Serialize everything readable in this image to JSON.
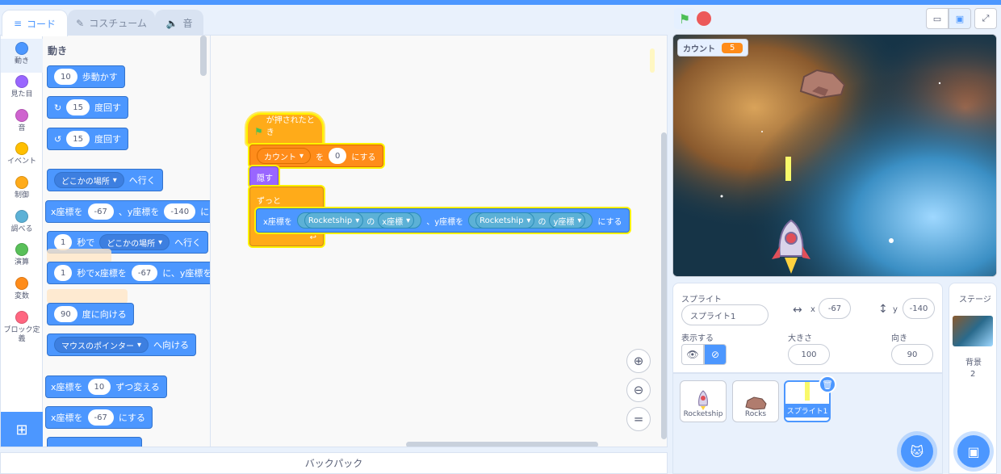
{
  "tabs": {
    "code": "コード",
    "costumes": "コスチューム",
    "sounds": "音"
  },
  "categories": [
    {
      "label": "動き",
      "color": "#4c97ff"
    },
    {
      "label": "見た目",
      "color": "#9966ff"
    },
    {
      "label": "音",
      "color": "#cf63cf"
    },
    {
      "label": "イベント",
      "color": "#ffbf00"
    },
    {
      "label": "制御",
      "color": "#ffab19"
    },
    {
      "label": "調べる",
      "color": "#5cb1d6"
    },
    {
      "label": "演算",
      "color": "#59c059"
    },
    {
      "label": "変数",
      "color": "#ff8c1a"
    },
    {
      "label": "ブロック定義",
      "color": "#ff6680"
    }
  ],
  "flyout": {
    "title": "動き",
    "move_val": "10",
    "move_label": "歩動かす",
    "turn_r_val": "15",
    "turn_r_label": "度回す",
    "turn_l_val": "15",
    "turn_l_label": "度回す",
    "goto_dd": "どこかの場所",
    "goto_label": "へ行く",
    "gotoxy_x_label": "x座標を",
    "gotoxy_x": "-67",
    "gotoxy_y_label": "、y座標を",
    "gotoxy_y": "-140",
    "gotoxy_end": "にする",
    "glide_val": "1",
    "glide_mid": "秒で",
    "glide_dd": "どこかの場所",
    "glide_end": "へ行く",
    "glidexy_val": "1",
    "glidexy_mid": "秒でx座標を",
    "glidexy_x": "-67",
    "glidexy_y_label": "に、y座標を",
    "point_val": "90",
    "point_label": "度に向ける",
    "pointto_dd": "マウスのポインター",
    "pointto_label": "へ向ける",
    "changex_label": "x座標を",
    "changex_val": "10",
    "changex_end": "ずつ変える",
    "setx_label": "x座標を",
    "setx_val": "-67",
    "setx_end": "にする"
  },
  "script": {
    "hat_label": "が押されたとき",
    "setvar_dd": "カウント",
    "setvar_mid": "を",
    "setvar_val": "0",
    "setvar_end": "にする",
    "hide_label": "隠す",
    "forever_label": "ずっと",
    "go_x_label": "x座標を",
    "go_x_sprite": "Rocketship",
    "go_of1": "の",
    "go_x_prop": "x座標",
    "go_y_label": "、y座標を",
    "go_y_sprite": "Rocketship",
    "go_of2": "の",
    "go_y_prop": "y座標",
    "go_end": "にする"
  },
  "backpack": "バックパック",
  "stage": {
    "var_name": "カウント",
    "var_value": "5"
  },
  "sprite_info": {
    "sprite_label": "スプライト",
    "sprite_name": "スプライト1",
    "x_label": "x",
    "x_val": "-67",
    "y_label": "y",
    "y_val": "-140",
    "show_label": "表示する",
    "size_label": "大きさ",
    "size_val": "100",
    "dir_label": "向き",
    "dir_val": "90"
  },
  "sprites": [
    {
      "name": "Rocketship"
    },
    {
      "name": "Rocks"
    },
    {
      "name": "スプライト1"
    }
  ],
  "stage_pane": {
    "title": "ステージ",
    "backdrop_label": "背景",
    "backdrop_count": "2"
  }
}
